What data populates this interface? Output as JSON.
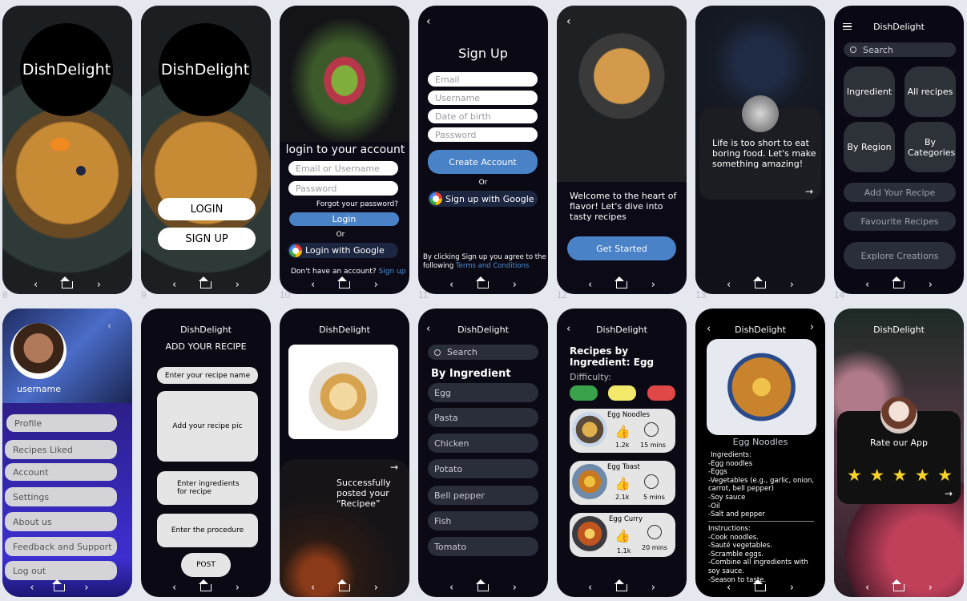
{
  "app_name": "DishDelight",
  "labels": {
    "f8": "8",
    "f9": "9",
    "f10": "10",
    "f11": "11",
    "f12": "12",
    "f13": "13",
    "f14": "14"
  },
  "nav": {
    "back": "‹",
    "forward": "›"
  },
  "screen9": {
    "login": "LOGIN",
    "signup": "SIGN UP"
  },
  "screen10": {
    "title": "login to your account",
    "email_placeholder": "Email or Username",
    "password_placeholder": "Password",
    "forgot": "Forgot your password?",
    "login": "Login",
    "or": "Or",
    "google": "Login with Google",
    "no_account": "Don't have an account?",
    "signup_link": "Sign up"
  },
  "screen11": {
    "back": "‹",
    "title": "Sign Up",
    "fields": [
      "Email",
      "Username",
      "Date of birth",
      "Password"
    ],
    "create": "Create Account",
    "or": "Or",
    "google": "Sign up with Google",
    "terms_prefix": "By clicking Sign up you agree to the following",
    "terms_link": "Terms and Conditions"
  },
  "screen12": {
    "back": "‹",
    "welcome": "Welcome to the heart of flavor! Let's dive into tasty recipes",
    "cta": "Get Started"
  },
  "screen13": {
    "quote": "Life is too short to eat boring food. Let's make something amazing!",
    "arrow": "→"
  },
  "screen14": {
    "search": "Search",
    "tiles": [
      "Ingredient",
      "All recipes",
      "By Region",
      "By Categories"
    ],
    "add": "Add Your Recipe",
    "fav": "Favourite Recipes",
    "explore": "Explore Creations"
  },
  "screen15": {
    "username": "username",
    "menu": [
      "Profile",
      "Recipes Liked",
      "Account",
      "Settings",
      "About us",
      "Feedback and Support",
      "Log out"
    ]
  },
  "screen16": {
    "title": "ADD YOUR RECIPE",
    "name": "Enter your recipe name",
    "pic": "Add your recipe pic",
    "ingredients": "Enter ingredients for recipe",
    "procedure": "Enter the procedure",
    "post": "POST"
  },
  "screen17": {
    "message": "Successfully posted your “Recipee”",
    "arrow": "→"
  },
  "screen18": {
    "search": "Search",
    "heading": "By Ingredient",
    "items": [
      "Egg",
      "Pasta",
      "Chicken",
      "Potato",
      "Bell pepper",
      "Fish",
      "Tomato"
    ]
  },
  "screen19": {
    "title": "Recipes by Ingredient: Egg",
    "difficulty": "Difficulty:",
    "difficulty_colors": [
      "#3aa24a",
      "#f2e86a",
      "#e04848"
    ],
    "recipes": [
      {
        "name": "Egg Noodles",
        "likes": "1.2k",
        "time": "15 mins"
      },
      {
        "name": "Egg Toast",
        "likes": "2.1k",
        "time": "5 mins"
      },
      {
        "name": "Egg Curry",
        "likes": "1.1k",
        "time": "20 mins"
      }
    ]
  },
  "screen20": {
    "dish": "Egg Noodles",
    "ingredients_title": "Ingredients:",
    "ingredients": [
      "-Egg noodles",
      "-Eggs",
      "-Vegetables (e.g., garlic, onion, carrot, bell pepper)",
      "-Soy sauce",
      "-Oil",
      "-Salt and pepper"
    ],
    "instructions_title": "Instructions:",
    "instructions": [
      "-Cook noodles.",
      "-Sauté vegetables.",
      "-Scramble eggs.",
      "-Combine all ingredients with soy sauce.",
      "-Season to taste."
    ]
  },
  "screen21": {
    "rate": "Rate our App",
    "stars": 5,
    "arrow": "→"
  }
}
